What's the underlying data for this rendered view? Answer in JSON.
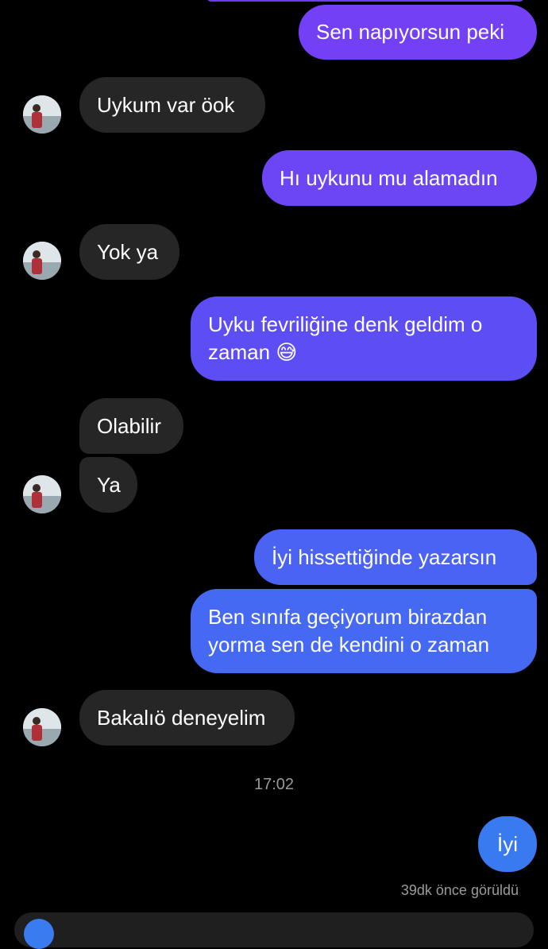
{
  "messages": [
    {
      "text": "Sen napıyorsun peki"
    },
    {
      "text": "Uykum var öok"
    },
    {
      "text": "Hı uykunu mu alamadın"
    },
    {
      "text": "Yok ya"
    },
    {
      "text": "Uyku fevriliğine denk geldim o zaman",
      "emoji": "😅"
    },
    {
      "text": "Olabilir"
    },
    {
      "text": "Ya"
    },
    {
      "text": "İyi hissettiğinde yazarsın"
    },
    {
      "text": "Ben sınıfa geçiyorum birazdan yorma sen de kendini o zaman"
    },
    {
      "text": "Bakalıö deneyelim"
    },
    {
      "text": "İyi"
    }
  ],
  "timestamp": "17:02",
  "seen_status": "39dk önce görüldü",
  "colors": {
    "incoming_bubble": "#262626",
    "outgoing_top": "#7440f6",
    "outgoing_mid": "#5a4ef3",
    "outgoing_bottom": "#3a7af0"
  },
  "icons": {
    "avatar": "contact-avatar",
    "composer": "camera-icon"
  }
}
